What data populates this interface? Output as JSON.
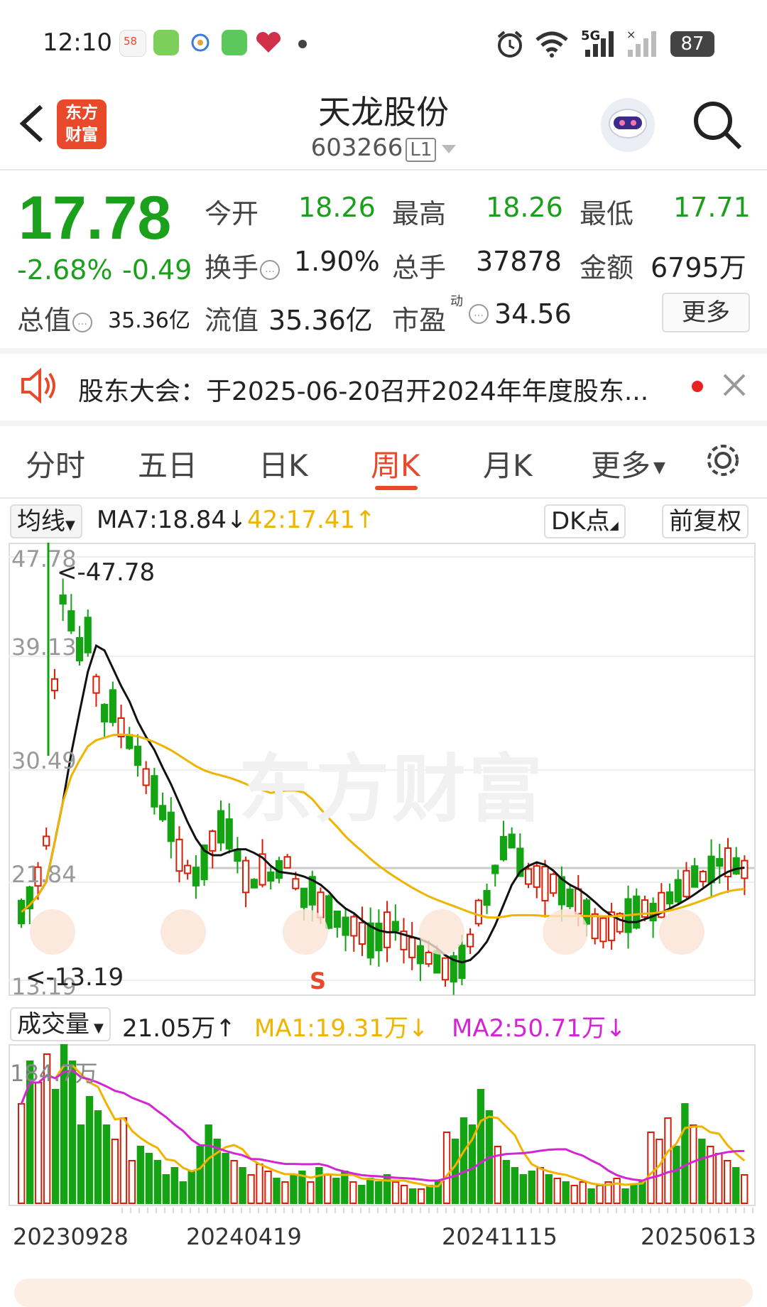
{
  "status_bar": {
    "time": "12:10",
    "network": "5G",
    "battery": "87"
  },
  "header": {
    "logo_text_1": "东方",
    "logo_text_2": "财富",
    "title": "天龙股份",
    "code": "603266",
    "level": "L1"
  },
  "quote": {
    "price": "17.78",
    "change_pct": "-2.68%",
    "change_abs": "-0.49",
    "open_label": "今开",
    "open": "18.26",
    "high_label": "最高",
    "high": "18.26",
    "low_label": "最低",
    "low": "17.71",
    "turnover_label": "换手",
    "turnover": "1.90%",
    "volume_label": "总手",
    "volume": "37878",
    "amount_label": "金额",
    "amount": "6795万",
    "mktcap_label": "总值",
    "mktcap": "35.36亿",
    "float_label": "流值",
    "float_cap": "35.36亿",
    "pe_label": "市盈",
    "pe_sup": "动",
    "pe": "34.56",
    "more": "更多"
  },
  "notice": {
    "text": "股东大会：于2025-06-20召开2024年年度股东..."
  },
  "tabs": [
    "分时",
    "五日",
    "日K",
    "周K",
    "月K",
    "更多"
  ],
  "active_tab": "周K",
  "kline": {
    "ma_dropdown": "均线",
    "ma7": "MA7:18.84",
    "ma42": "42:17.41",
    "dk_button": "DK点",
    "adjust_button": "前复权",
    "y_labels": [
      "47.78",
      "39.13",
      "30.49",
      "21.84",
      "13.19"
    ],
    "max_marker": "<-47.78",
    "min_marker": "<-13.19",
    "watermark": "东方财富",
    "signal_s": "S"
  },
  "volume": {
    "dropdown": "成交量",
    "current": "21.05万",
    "ma1": "MA1:19.31万",
    "ma2": "MA2:50.71万",
    "max_label": "184.7万"
  },
  "dates": [
    "20230928",
    "20240419",
    "20241115",
    "20250613"
  ],
  "colors": {
    "up": "#d81e06",
    "down": "#13a313",
    "ma_black": "#111111",
    "ma_yellow": "#f0b400",
    "ma_magenta": "#d325d3",
    "accent": "#e8492a"
  }
}
